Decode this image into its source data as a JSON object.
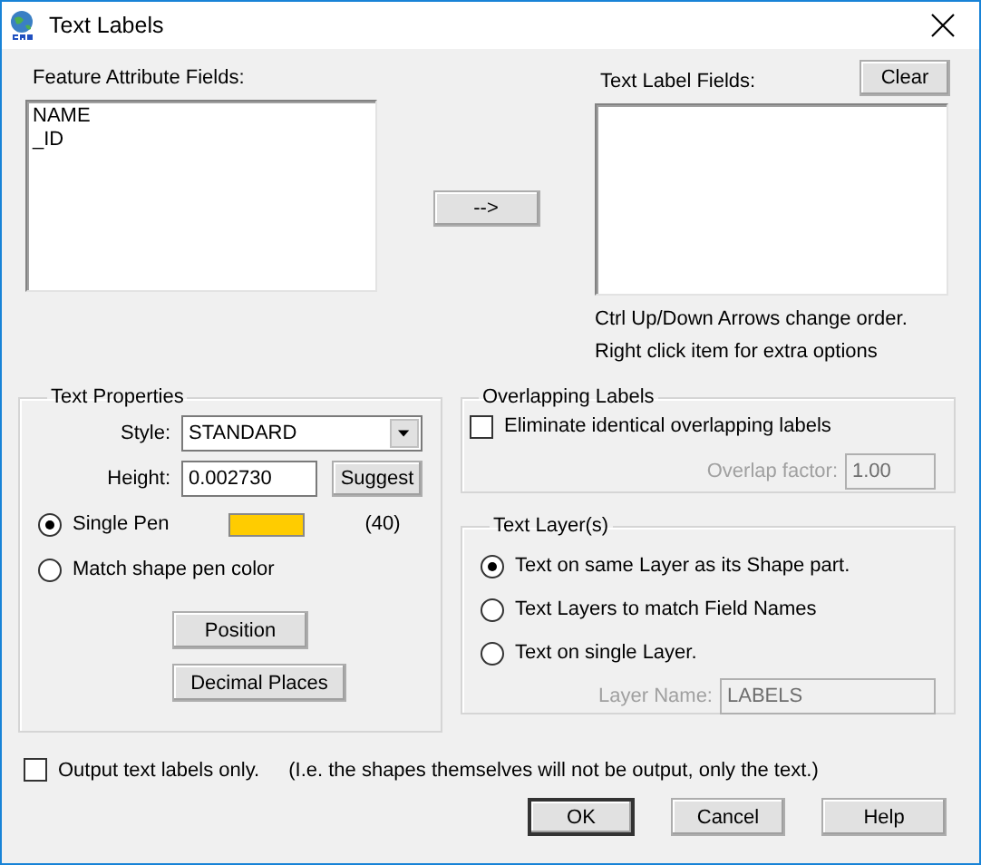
{
  "window": {
    "title": "Text Labels"
  },
  "feature_fields": {
    "label": "Feature Attribute Fields:",
    "items": [
      {
        "text": "NAME"
      },
      {
        "text": "_ID"
      }
    ]
  },
  "add_button": "-->",
  "text_label_fields": {
    "label": "Text Label Fields:",
    "clear_button": "Clear",
    "hints": [
      "Ctrl Up/Down Arrows change order.",
      "Right click item for extra options"
    ]
  },
  "text_properties": {
    "title": "Text Properties",
    "style_label": "Style:",
    "style_value": "STANDARD",
    "height_label": "Height:",
    "height_value": "0.002730",
    "suggest_button": "Suggest",
    "pen_options": [
      {
        "label": "Single Pen",
        "selected": true,
        "kind": "swatch",
        "color": "#ffcc00",
        "pen_number": "(40)"
      },
      {
        "label": "Match shape pen color",
        "selected": false,
        "kind": "plain"
      }
    ],
    "buttons": [
      "Position",
      "Decimal Places"
    ]
  },
  "overlapping_labels": {
    "title": "Overlapping Labels",
    "eliminate": {
      "label": "Eliminate identical overlapping labels",
      "checked": false
    },
    "overlap_factor": {
      "label": "Overlap factor:",
      "value": "1.00",
      "disabled": true
    }
  },
  "text_layers": {
    "title": "Text Layer(s)",
    "options": [
      {
        "label": "Text on same Layer as its Shape part.",
        "selected": true
      },
      {
        "label": "Text Layers to match Field Names",
        "selected": false
      },
      {
        "label": "Text on single Layer.",
        "selected": false
      }
    ],
    "layer_name": {
      "label": "Layer Name:",
      "value": "LABELS",
      "disabled": true
    }
  },
  "output_only": {
    "label": "Output text labels only.",
    "note": "(I.e. the shapes themselves will not be output, only the text.)",
    "checked": false
  },
  "buttons": [
    {
      "label": "OK",
      "default": true
    },
    {
      "label": "Cancel",
      "default": false
    },
    {
      "label": "Help",
      "default": false
    }
  ]
}
